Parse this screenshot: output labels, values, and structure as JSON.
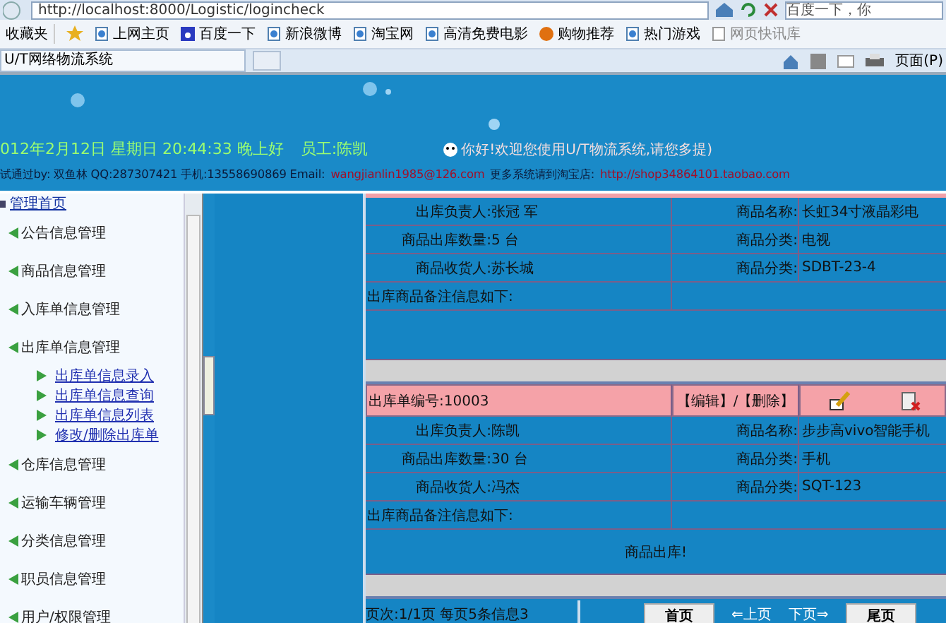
{
  "browser": {
    "address": "http://localhost:8000/Logistic/logincheck",
    "search_text": "百度一下，你",
    "favorites_label": "收藏夹",
    "bookmarks": [
      {
        "label": "上网主页",
        "kind": "page"
      },
      {
        "label": "百度一下",
        "kind": "paw"
      },
      {
        "label": "新浪微博",
        "kind": "page"
      },
      {
        "label": "淘宝网",
        "kind": "page"
      },
      {
        "label": "高清免费电影",
        "kind": "page"
      },
      {
        "label": "购物推荐",
        "kind": "shop"
      },
      {
        "label": "热门游戏",
        "kind": "page"
      },
      {
        "label": "网页快讯库",
        "kind": "feed"
      }
    ],
    "tab_title": "U/T网络物流系统",
    "page_menu": "页面(P)"
  },
  "header": {
    "date_line": "012年2月12日 星期日 20:44:33 晚上好",
    "employee": "员工:陈凯",
    "welcome": "你好!欢迎您使用U/T物流系统,请您多提)",
    "credits": "试通过by: 双鱼林 QQ:287307421 手机:13558690869 Email:",
    "email": "wangjianlin1985@126.com",
    "shop_label": "更多系统请到淘宝店:",
    "shop_url": "http://shop34864101.taobao.com"
  },
  "sidebar": {
    "home_link": "管理首页",
    "items": [
      {
        "label": "公告信息管理"
      },
      {
        "label": "商品信息管理"
      },
      {
        "label": "入库单信息管理"
      },
      {
        "label": "出库单信息管理",
        "children": [
          {
            "label": "出库单信息录入"
          },
          {
            "label": "出库单信息查询"
          },
          {
            "label": "出库单信息列表"
          },
          {
            "label": "修改/删除出库单"
          }
        ]
      },
      {
        "label": "仓库信息管理"
      },
      {
        "label": "运输车辆管理"
      },
      {
        "label": "分类信息管理"
      },
      {
        "label": "职员信息管理"
      },
      {
        "label": "用户/权限管理"
      }
    ]
  },
  "records": [
    {
      "rows": [
        {
          "label": "出库负责人:",
          "value": "张冠 军",
          "label_2": "商品名称:",
          "value_2": "长虹34寸液晶彩电"
        },
        {
          "label": "商品出库数量:",
          "value": "5 台",
          "label_2": "商品分类:",
          "value_2": "电视"
        },
        {
          "label": "商品收货人:",
          "value": "苏长城",
          "label_2": "商品分类:",
          "value_2": "SDBT-23-4"
        }
      ],
      "remark_label": "出库商品备注信息如下:"
    },
    {
      "number": "出库单编号:10003",
      "actions": "【编辑】/【删除】",
      "rows": [
        {
          "label": "出库负责人:",
          "value": "陈凯",
          "label_2": "商品名称:",
          "value_2": "步步高vivo智能手机"
        },
        {
          "label": "商品出库数量:",
          "value": "30 台",
          "label_2": "商品分类:",
          "value_2": "手机"
        },
        {
          "label": "商品收货人:",
          "value": "冯杰",
          "label_2": "商品分类:",
          "value_2": "SQT-123"
        }
      ],
      "remark_label": "出库商品备注信息如下:",
      "remark": "商品出库!"
    }
  ],
  "pager": {
    "info": "页次:1/1页 每页5条信息3",
    "first": "首页",
    "prev": "⇐上页",
    "next": "下页⇒",
    "last": "尾页"
  }
}
